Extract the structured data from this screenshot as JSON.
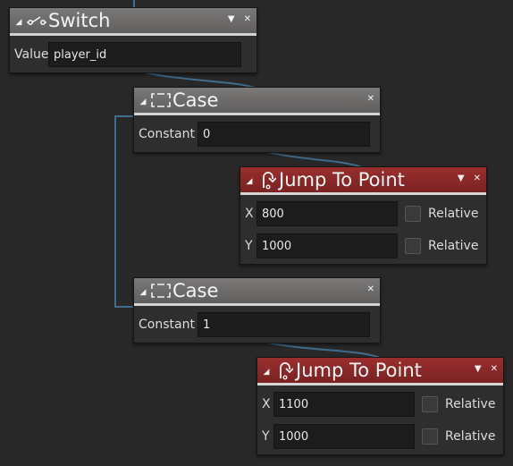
{
  "colors": {
    "background": "#282828",
    "neutral_header": "#6b6868",
    "action_header": "#8b2828",
    "wire": "#3f6d8e"
  },
  "switch_node": {
    "title": "Switch",
    "icon": "switch-icon",
    "value_label": "Value",
    "value": "player_id"
  },
  "case_nodes": [
    {
      "title": "Case",
      "icon": "case-bracket-icon",
      "constant_label": "Constant",
      "constant": "0"
    },
    {
      "title": "Case",
      "icon": "case-bracket-icon",
      "constant_label": "Constant",
      "constant": "1"
    }
  ],
  "jump_nodes": [
    {
      "title": "Jump To Point",
      "icon": "jump-arrow-icon",
      "x_label": "X",
      "x": "800",
      "y_label": "Y",
      "y": "1000",
      "relative_label": "Relative",
      "x_relative": false,
      "y_relative": false
    },
    {
      "title": "Jump To Point",
      "icon": "jump-arrow-icon",
      "x_label": "X",
      "x": "1100",
      "y_label": "Y",
      "y": "1000",
      "relative_label": "Relative",
      "x_relative": false,
      "y_relative": false
    }
  ],
  "header_buttons": {
    "collapse": "◢",
    "menu": "▼",
    "close": "✕"
  }
}
